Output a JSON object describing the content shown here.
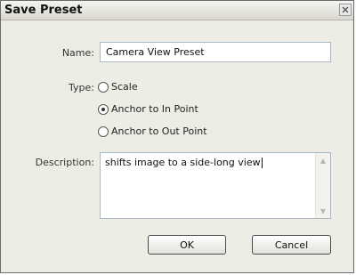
{
  "dialog": {
    "title": "Save Preset",
    "close_icon": "close-icon"
  },
  "form": {
    "name_label": "Name:",
    "name_value": "Camera View Preset",
    "type_label": "Type:",
    "type_options": [
      {
        "label": "Scale",
        "selected": false
      },
      {
        "label": "Anchor to In Point",
        "selected": true
      },
      {
        "label": "Anchor to Out Point",
        "selected": false
      }
    ],
    "description_label": "Description:",
    "description_value": "shifts image to a side-long view"
  },
  "buttons": {
    "ok_label": "OK",
    "cancel_label": "Cancel"
  }
}
